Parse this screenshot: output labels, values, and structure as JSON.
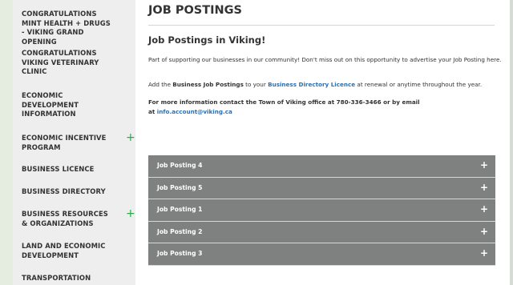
{
  "sidebar": {
    "items": [
      {
        "label": "CONGRATULATIONS MINT HEALTH + DRUGS - VIKING GRAND OPENING",
        "expandable": false
      },
      {
        "label": "CONGRATULATIONS VIKING VETERINARY CLINIC",
        "expandable": false
      },
      {
        "label": "ECONOMIC DEVELOPMENT INFORMATION",
        "expandable": false
      },
      {
        "label": "ECONOMIC INCENTIVE PROGRAM",
        "expandable": true
      },
      {
        "label": "BUSINESS LICENCE",
        "expandable": false
      },
      {
        "label": "BUSINESS DIRECTORY",
        "expandable": false
      },
      {
        "label": "BUSINESS RESOURCES & ORGANIZATIONS",
        "expandable": true
      },
      {
        "label": "LAND AND ECONOMIC DEVELOPMENT",
        "expandable": false
      },
      {
        "label": "TRANSPORTATION",
        "expandable": false
      }
    ],
    "expand_icon": "+"
  },
  "main": {
    "page_title": "JOB POSTINGS",
    "section_heading": "Job Postings in Viking!",
    "para1": "Part of supporting our businesses in our community! Don't miss out on this opportunity to advertise your Job Posting here.",
    "para2": {
      "prefix": "Add the ",
      "bold": "Business Job Postings",
      "middle": " to your ",
      "link": "Business Directory Licence",
      "suffix": " at renewal or anytime throughout the year."
    },
    "para3": {
      "line1": "For more information contact the Town of Viking office at 780-336-3466 or by email",
      "at": "at ",
      "email": "info.account@viking.ca"
    },
    "accordion": [
      {
        "label": "Job Posting 4",
        "icon": "+"
      },
      {
        "label": "Job Posting 5",
        "icon": "+"
      },
      {
        "label": "Job Posting 1",
        "icon": "+"
      },
      {
        "label": "Job Posting 2",
        "icon": "+"
      },
      {
        "label": "Job Posting 3",
        "icon": "+"
      }
    ]
  },
  "colors": {
    "background": "#e4ede0",
    "sidebar": "#eeeeee",
    "accent_green": "#2aa84a",
    "link_blue": "#2b6fb5",
    "accordion_bg": "#7e8180"
  }
}
